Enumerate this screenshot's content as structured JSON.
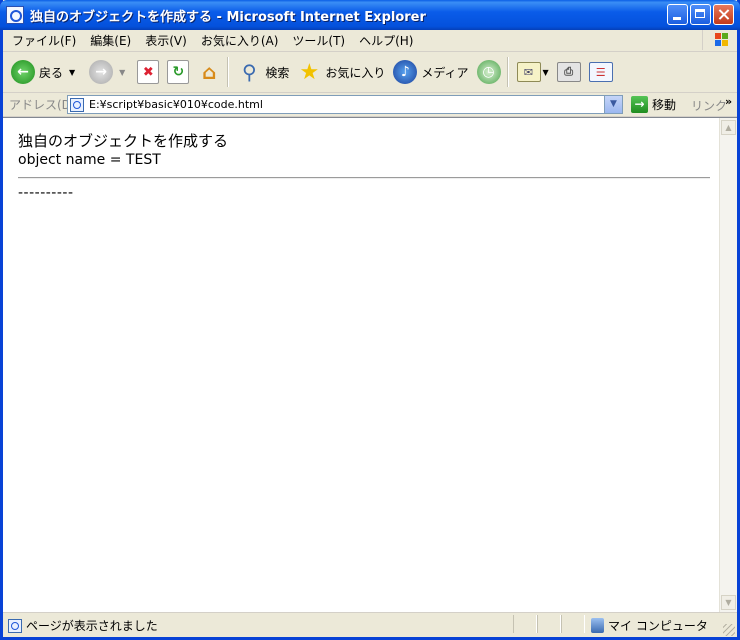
{
  "window": {
    "title": "独自のオブジェクトを作成する - Microsoft Internet Explorer"
  },
  "menu": {
    "items": [
      "ファイル(F)",
      "編集(E)",
      "表示(V)",
      "お気に入り(A)",
      "ツール(T)",
      "ヘルプ(H)"
    ]
  },
  "toolbar": {
    "back_label": "戻る",
    "search_label": "検索",
    "favorites_label": "お気に入り",
    "media_label": "メディア"
  },
  "address": {
    "label": "アドレス(D)",
    "url": "E:¥script¥basic¥010¥code.html",
    "go_label": "移動",
    "links_label": "リンク"
  },
  "page": {
    "heading": "独自のオブジェクトを作成する",
    "output_line": "object name = TEST",
    "dash_line": "----------"
  },
  "status": {
    "text": "ページが表示されました",
    "zone": "マイ コンピュータ"
  },
  "colors": {
    "titlebar": "#0a5ce9",
    "chrome": "#ece9d8",
    "content_bg": "#ffffff"
  }
}
